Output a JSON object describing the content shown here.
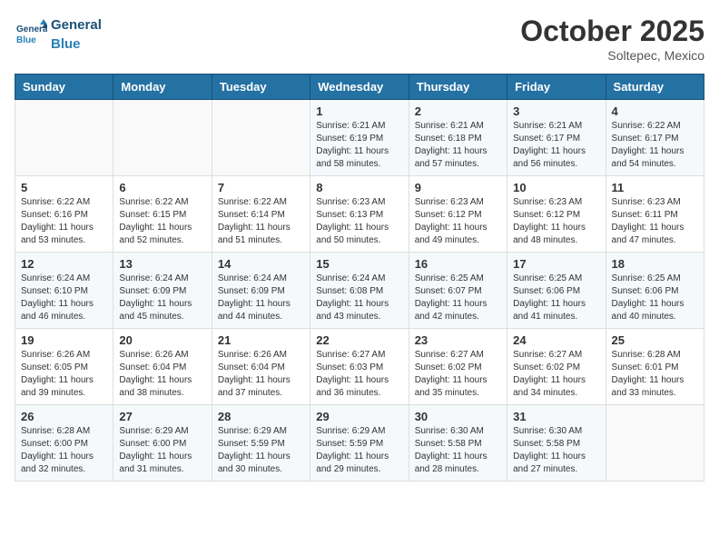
{
  "header": {
    "logo_general": "General",
    "logo_blue": "Blue",
    "month_title": "October 2025",
    "location": "Soltepec, Mexico"
  },
  "weekdays": [
    "Sunday",
    "Monday",
    "Tuesday",
    "Wednesday",
    "Thursday",
    "Friday",
    "Saturday"
  ],
  "weeks": [
    [
      {
        "day": "",
        "sunrise": "",
        "sunset": "",
        "daylight": ""
      },
      {
        "day": "",
        "sunrise": "",
        "sunset": "",
        "daylight": ""
      },
      {
        "day": "",
        "sunrise": "",
        "sunset": "",
        "daylight": ""
      },
      {
        "day": "1",
        "sunrise": "Sunrise: 6:21 AM",
        "sunset": "Sunset: 6:19 PM",
        "daylight": "Daylight: 11 hours and 58 minutes."
      },
      {
        "day": "2",
        "sunrise": "Sunrise: 6:21 AM",
        "sunset": "Sunset: 6:18 PM",
        "daylight": "Daylight: 11 hours and 57 minutes."
      },
      {
        "day": "3",
        "sunrise": "Sunrise: 6:21 AM",
        "sunset": "Sunset: 6:17 PM",
        "daylight": "Daylight: 11 hours and 56 minutes."
      },
      {
        "day": "4",
        "sunrise": "Sunrise: 6:22 AM",
        "sunset": "Sunset: 6:17 PM",
        "daylight": "Daylight: 11 hours and 54 minutes."
      }
    ],
    [
      {
        "day": "5",
        "sunrise": "Sunrise: 6:22 AM",
        "sunset": "Sunset: 6:16 PM",
        "daylight": "Daylight: 11 hours and 53 minutes."
      },
      {
        "day": "6",
        "sunrise": "Sunrise: 6:22 AM",
        "sunset": "Sunset: 6:15 PM",
        "daylight": "Daylight: 11 hours and 52 minutes."
      },
      {
        "day": "7",
        "sunrise": "Sunrise: 6:22 AM",
        "sunset": "Sunset: 6:14 PM",
        "daylight": "Daylight: 11 hours and 51 minutes."
      },
      {
        "day": "8",
        "sunrise": "Sunrise: 6:23 AM",
        "sunset": "Sunset: 6:13 PM",
        "daylight": "Daylight: 11 hours and 50 minutes."
      },
      {
        "day": "9",
        "sunrise": "Sunrise: 6:23 AM",
        "sunset": "Sunset: 6:12 PM",
        "daylight": "Daylight: 11 hours and 49 minutes."
      },
      {
        "day": "10",
        "sunrise": "Sunrise: 6:23 AM",
        "sunset": "Sunset: 6:12 PM",
        "daylight": "Daylight: 11 hours and 48 minutes."
      },
      {
        "day": "11",
        "sunrise": "Sunrise: 6:23 AM",
        "sunset": "Sunset: 6:11 PM",
        "daylight": "Daylight: 11 hours and 47 minutes."
      }
    ],
    [
      {
        "day": "12",
        "sunrise": "Sunrise: 6:24 AM",
        "sunset": "Sunset: 6:10 PM",
        "daylight": "Daylight: 11 hours and 46 minutes."
      },
      {
        "day": "13",
        "sunrise": "Sunrise: 6:24 AM",
        "sunset": "Sunset: 6:09 PM",
        "daylight": "Daylight: 11 hours and 45 minutes."
      },
      {
        "day": "14",
        "sunrise": "Sunrise: 6:24 AM",
        "sunset": "Sunset: 6:09 PM",
        "daylight": "Daylight: 11 hours and 44 minutes."
      },
      {
        "day": "15",
        "sunrise": "Sunrise: 6:24 AM",
        "sunset": "Sunset: 6:08 PM",
        "daylight": "Daylight: 11 hours and 43 minutes."
      },
      {
        "day": "16",
        "sunrise": "Sunrise: 6:25 AM",
        "sunset": "Sunset: 6:07 PM",
        "daylight": "Daylight: 11 hours and 42 minutes."
      },
      {
        "day": "17",
        "sunrise": "Sunrise: 6:25 AM",
        "sunset": "Sunset: 6:06 PM",
        "daylight": "Daylight: 11 hours and 41 minutes."
      },
      {
        "day": "18",
        "sunrise": "Sunrise: 6:25 AM",
        "sunset": "Sunset: 6:06 PM",
        "daylight": "Daylight: 11 hours and 40 minutes."
      }
    ],
    [
      {
        "day": "19",
        "sunrise": "Sunrise: 6:26 AM",
        "sunset": "Sunset: 6:05 PM",
        "daylight": "Daylight: 11 hours and 39 minutes."
      },
      {
        "day": "20",
        "sunrise": "Sunrise: 6:26 AM",
        "sunset": "Sunset: 6:04 PM",
        "daylight": "Daylight: 11 hours and 38 minutes."
      },
      {
        "day": "21",
        "sunrise": "Sunrise: 6:26 AM",
        "sunset": "Sunset: 6:04 PM",
        "daylight": "Daylight: 11 hours and 37 minutes."
      },
      {
        "day": "22",
        "sunrise": "Sunrise: 6:27 AM",
        "sunset": "Sunset: 6:03 PM",
        "daylight": "Daylight: 11 hours and 36 minutes."
      },
      {
        "day": "23",
        "sunrise": "Sunrise: 6:27 AM",
        "sunset": "Sunset: 6:02 PM",
        "daylight": "Daylight: 11 hours and 35 minutes."
      },
      {
        "day": "24",
        "sunrise": "Sunrise: 6:27 AM",
        "sunset": "Sunset: 6:02 PM",
        "daylight": "Daylight: 11 hours and 34 minutes."
      },
      {
        "day": "25",
        "sunrise": "Sunrise: 6:28 AM",
        "sunset": "Sunset: 6:01 PM",
        "daylight": "Daylight: 11 hours and 33 minutes."
      }
    ],
    [
      {
        "day": "26",
        "sunrise": "Sunrise: 6:28 AM",
        "sunset": "Sunset: 6:00 PM",
        "daylight": "Daylight: 11 hours and 32 minutes."
      },
      {
        "day": "27",
        "sunrise": "Sunrise: 6:29 AM",
        "sunset": "Sunset: 6:00 PM",
        "daylight": "Daylight: 11 hours and 31 minutes."
      },
      {
        "day": "28",
        "sunrise": "Sunrise: 6:29 AM",
        "sunset": "Sunset: 5:59 PM",
        "daylight": "Daylight: 11 hours and 30 minutes."
      },
      {
        "day": "29",
        "sunrise": "Sunrise: 6:29 AM",
        "sunset": "Sunset: 5:59 PM",
        "daylight": "Daylight: 11 hours and 29 minutes."
      },
      {
        "day": "30",
        "sunrise": "Sunrise: 6:30 AM",
        "sunset": "Sunset: 5:58 PM",
        "daylight": "Daylight: 11 hours and 28 minutes."
      },
      {
        "day": "31",
        "sunrise": "Sunrise: 6:30 AM",
        "sunset": "Sunset: 5:58 PM",
        "daylight": "Daylight: 11 hours and 27 minutes."
      },
      {
        "day": "",
        "sunrise": "",
        "sunset": "",
        "daylight": ""
      }
    ]
  ]
}
